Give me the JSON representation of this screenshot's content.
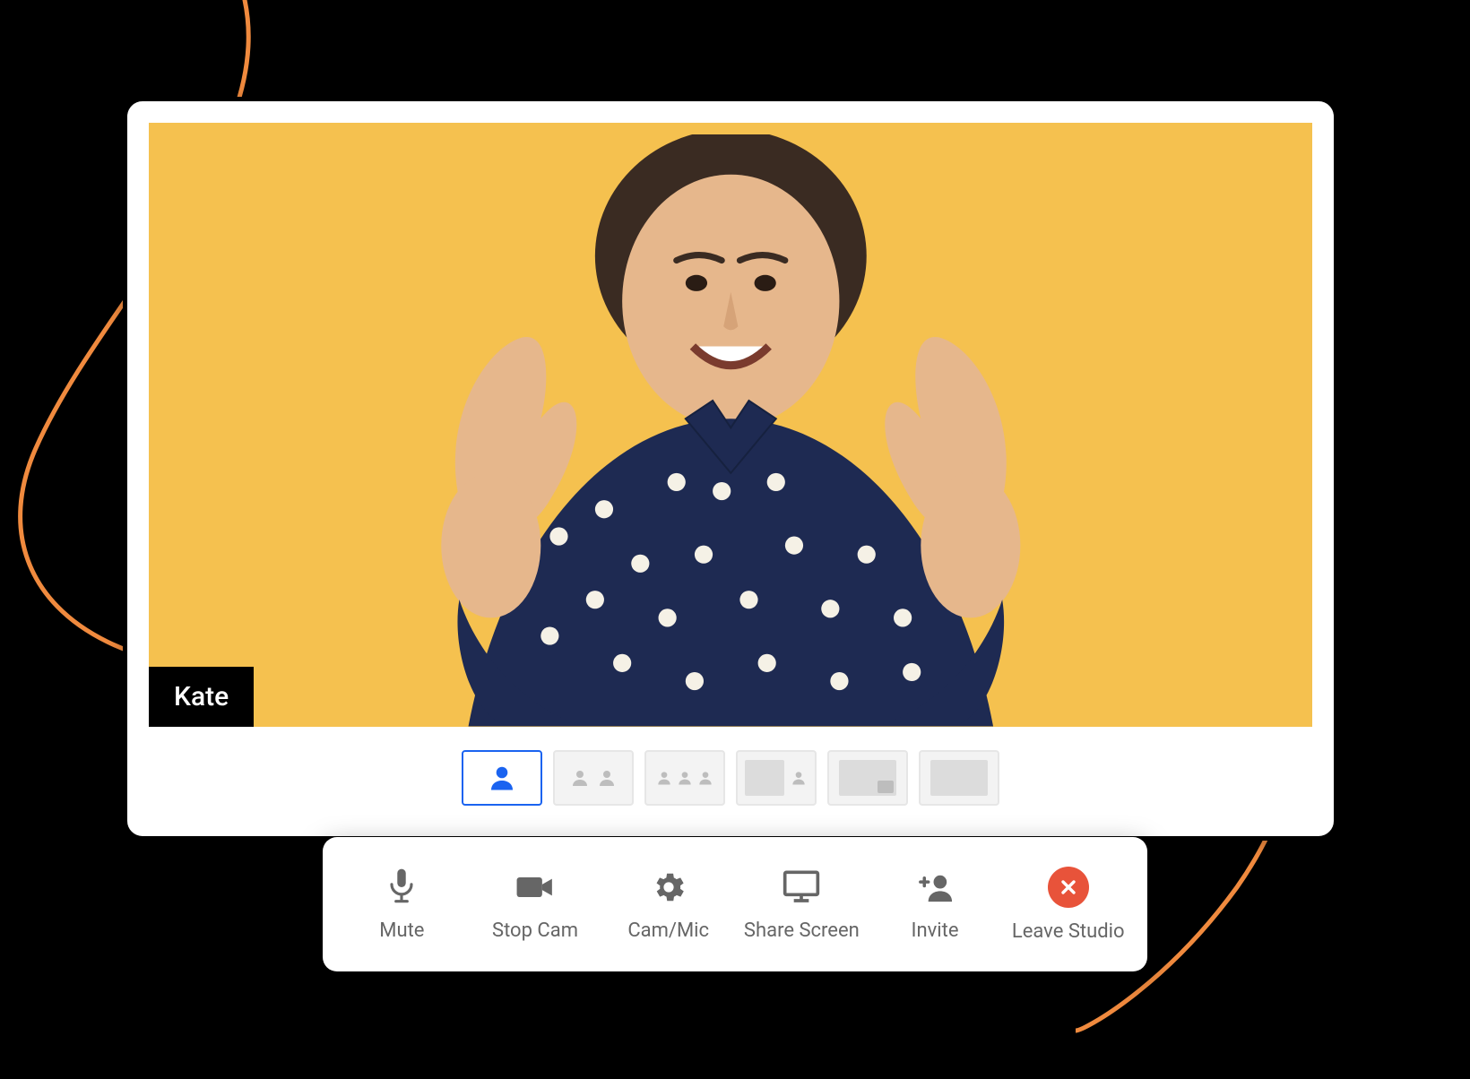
{
  "participant": {
    "name": "Kate"
  },
  "layouts": {
    "count": 6,
    "active_index": 0
  },
  "controls": {
    "mute": {
      "label": "Mute",
      "icon": "microphone-icon"
    },
    "stop_cam": {
      "label": "Stop Cam",
      "icon": "camera-icon"
    },
    "cam_mic": {
      "label": "Cam/Mic",
      "icon": "gear-icon"
    },
    "share_screen": {
      "label": "Share Screen",
      "icon": "monitor-icon"
    },
    "invite": {
      "label": "Invite",
      "icon": "add-user-icon"
    },
    "leave": {
      "label": "Leave Studio",
      "icon": "close-icon"
    }
  },
  "colors": {
    "video_bg": "#f5c14f",
    "accent_blue": "#1a63f0",
    "leave_red": "#e8533a",
    "swirl_orange": "#f08a3e"
  }
}
